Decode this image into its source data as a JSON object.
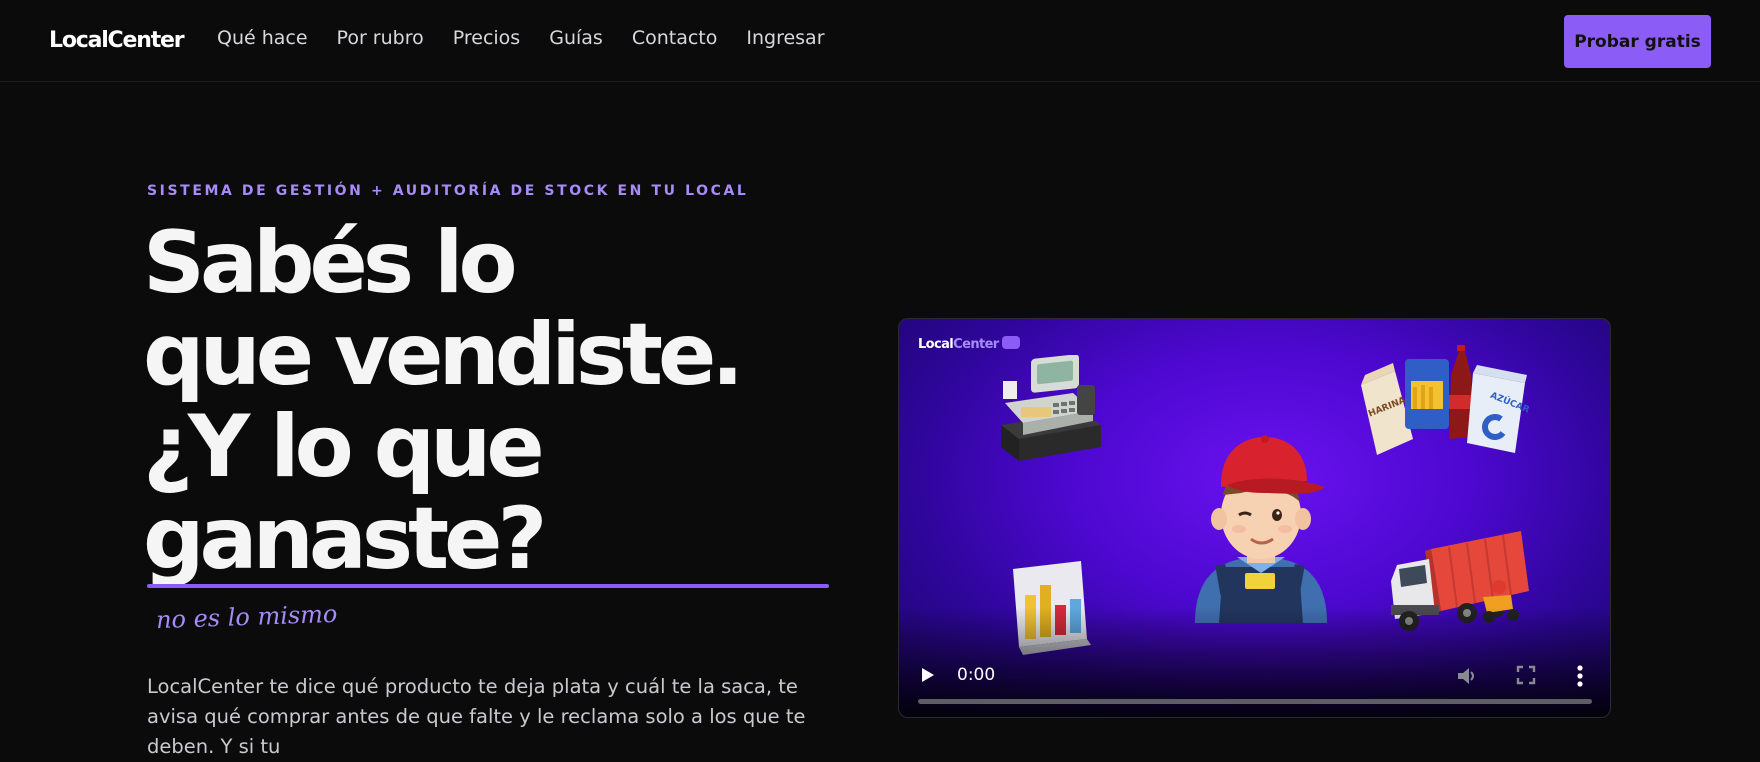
{
  "nav": {
    "logo": "LocalCenter",
    "links": [
      "Qué hace",
      "Por rubro",
      "Precios",
      "Guías",
      "Contacto",
      "Ingresar"
    ],
    "cta": "Probar gratis"
  },
  "hero": {
    "eyebrow": "SISTEMA DE GESTIÓN + AUDITORÍA DE STOCK EN TU LOCAL",
    "headline": [
      "Sabés lo",
      "que vendiste.",
      "¿Y lo que",
      "ganaste?"
    ],
    "handnote": "no es lo mismo",
    "lead": "LocalCenter te dice qué producto te deja plata y cuál te la saca, te avisa qué comprar antes de que falte y le reclama solo a los que te deben. Y si tu"
  },
  "video": {
    "logo_main": "Local",
    "logo_light": "Center",
    "time": "0:00",
    "progress": 0,
    "icons": [
      "cash-register-icon",
      "groceries-icon",
      "shopkeeper-avatar",
      "bar-chart-icon",
      "truck-icon"
    ],
    "colors": {
      "accent": "#8b5cf6",
      "bg_center": "#6a12f0",
      "bg_edge": "#1b0566"
    }
  }
}
